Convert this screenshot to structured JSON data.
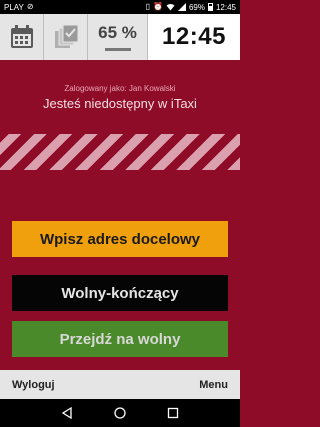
{
  "status_bar": {
    "carrier": "PLAY",
    "battery": "69%",
    "time": "12:45"
  },
  "top_bar": {
    "percent": "65 %",
    "clock": "12:45"
  },
  "main": {
    "login_label": "Zalogowany jako: Jan Kowalski",
    "status_text": "Jesteś niedostępny w iTaxi"
  },
  "buttons": {
    "destination": "Wpisz adres docelowy",
    "free_finishing": "Wolny-kończący",
    "go_free": "Przejdź na wolny"
  },
  "bottom_bar": {
    "logout": "Wyloguj",
    "menu": "Menu"
  },
  "colors": {
    "background": "#8f0c28",
    "orange": "#f09f0d",
    "green": "#4b8a2a"
  }
}
